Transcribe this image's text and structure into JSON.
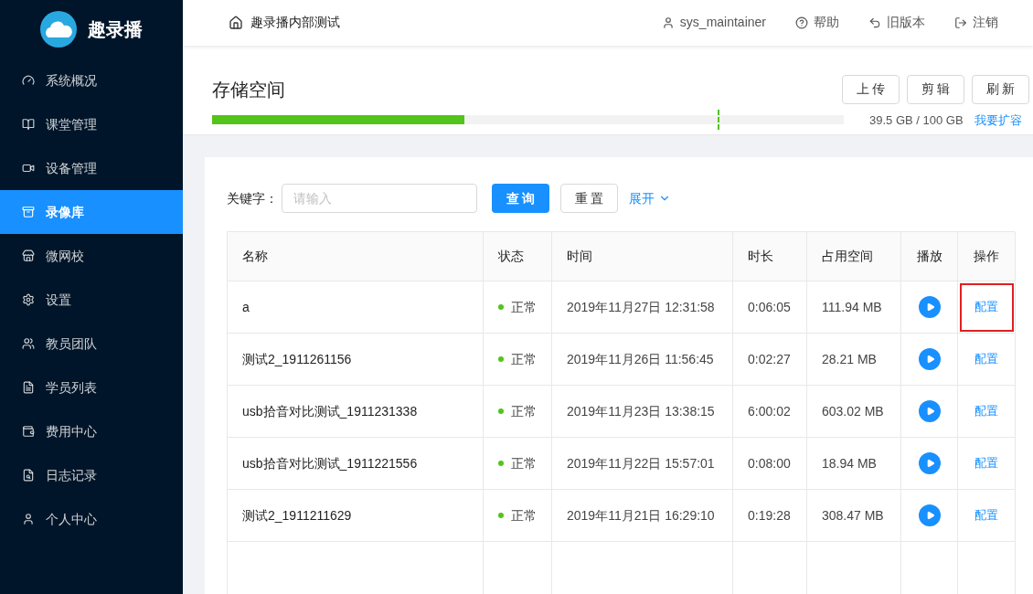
{
  "sidebar": {
    "logo": "趣录播",
    "items": [
      {
        "label": "系统概况",
        "selected": false
      },
      {
        "label": "课堂管理",
        "selected": false
      },
      {
        "label": "设备管理",
        "selected": false
      },
      {
        "label": "录像库",
        "selected": true
      },
      {
        "label": "微网校",
        "selected": false
      },
      {
        "label": "设置",
        "selected": false
      },
      {
        "label": "教员团队",
        "selected": false
      },
      {
        "label": "学员列表",
        "selected": false
      },
      {
        "label": "费用中心",
        "selected": false
      },
      {
        "label": "日志记录",
        "selected": false
      },
      {
        "label": "个人中心",
        "selected": false
      }
    ]
  },
  "header": {
    "breadcrumb": "趣录播内部测试",
    "user": "sys_maintainer",
    "links": [
      "帮助",
      "旧版本",
      "注销"
    ]
  },
  "storage": {
    "title": "存储空间",
    "buttons": [
      "上 传",
      "剪 辑",
      "刷 新"
    ],
    "level": 0.4,
    "usage": "39.5 GB / 100 GB",
    "expand_link": "我要扩容"
  },
  "search": {
    "label": "关键字：",
    "placeholder": "请输入",
    "query_button": "查 询",
    "reset_button": "重 置",
    "expand_link": "展开"
  },
  "table": {
    "columns": [
      "名称",
      "状态",
      "时间",
      "时长",
      "占用空间",
      "播放",
      "操作"
    ],
    "rows": [
      {
        "name": "a",
        "status": "正常",
        "color": "#52c41a",
        "time": "2019年11月27日 12:31:58",
        "duration": "0:06:05",
        "size": "111.94 MB",
        "action": "配置",
        "highlighted": true
      },
      {
        "name": "测试2_1911261156",
        "status": "正常",
        "color": "#52c41a",
        "time": "2019年11月26日 11:56:45",
        "duration": "0:02:27",
        "size": "28.21 MB",
        "action": "配置",
        "highlighted": false
      },
      {
        "name": "usb拾音对比测试_1911231338",
        "status": "正常",
        "color": "#52c41a",
        "time": "2019年11月23日 13:38:15",
        "duration": "6:00:02",
        "size": "603.02 MB",
        "action": "配置",
        "highlighted": false
      },
      {
        "name": "usb拾音对比测试_1911221556",
        "status": "正常",
        "color": "#52c41a",
        "time": "2019年11月22日 15:57:01",
        "duration": "0:08:00",
        "size": "18.94 MB",
        "action": "配置",
        "highlighted": false
      },
      {
        "name": "测试2_1911211629",
        "status": "正常",
        "color": "#52c41a",
        "time": "2019年11月21日 16:29:10",
        "duration": "0:19:28",
        "size": "308.47 MB",
        "action": "配置",
        "highlighted": false
      }
    ]
  }
}
